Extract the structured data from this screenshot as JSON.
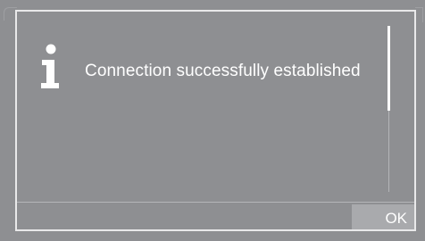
{
  "dialog": {
    "icon": "info-icon",
    "message": "Connection successfully established",
    "ok_label": "OK"
  },
  "colors": {
    "background": "#8e8f92",
    "border": "#e9e9ea",
    "text": "#ffffff",
    "button": "#a9aaad"
  }
}
